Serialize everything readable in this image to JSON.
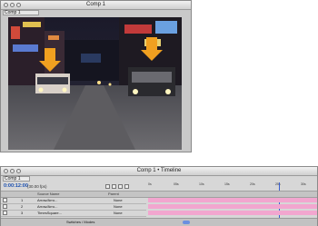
{
  "comp_window": {
    "title": "Comp 1",
    "tab_label": "Comp 1"
  },
  "timeline_window": {
    "title": "Comp 1 • Timeline",
    "tab_label": "Comp 1",
    "timecode": "0:00:12:00",
    "fps": "(30.00 fps)",
    "columns": {
      "source_name": "Source Name",
      "parent": "Parent"
    },
    "layers": [
      {
        "index": "1",
        "name": "Arrow/Arro...",
        "parent": "None"
      },
      {
        "index": "2",
        "name": "Arrow/Arro...",
        "parent": "None"
      },
      {
        "index": "3",
        "name": "TimesSquare...",
        "parent": "None"
      }
    ],
    "ruler_ticks": [
      "0s",
      "05s",
      "10s",
      "15s",
      "20s",
      "25s",
      "30s"
    ],
    "bottom_toggle": "Switches / Modes"
  },
  "colors": {
    "track": "#f2a6cf",
    "arrow": "#f0a020",
    "timecode": "#1a4fb0"
  }
}
